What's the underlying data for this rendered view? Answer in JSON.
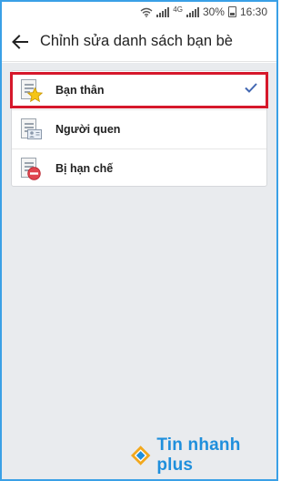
{
  "status_bar": {
    "network": "4G",
    "battery": "30%",
    "time": "16:30"
  },
  "app_bar": {
    "title": "Chỉnh sửa danh sách bạn bè",
    "back_icon": "arrow-left-icon"
  },
  "lists": [
    {
      "label": "Bạn thân",
      "icon": "close-friends-star-icon",
      "selected": true
    },
    {
      "label": "Người quen",
      "icon": "acquaintances-card-icon",
      "selected": false
    },
    {
      "label": "Bị hạn chế",
      "icon": "restricted-no-entry-icon",
      "selected": false
    }
  ],
  "colors": {
    "accent": "#4267b2",
    "highlight_border": "#d6182b",
    "background": "#e9ebee",
    "watermark": "#1f8fdc"
  },
  "watermark": {
    "text": "Tin nhanh plus"
  }
}
